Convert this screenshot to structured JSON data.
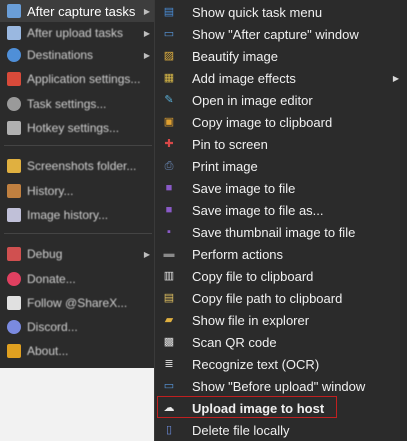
{
  "parent_menu": {
    "items": [
      {
        "label": "After capture tasks",
        "icon": "capture-tasks-icon",
        "color": "#6a9ed8"
      },
      {
        "label": "After upload tasks",
        "icon": "cloud-upload-icon",
        "color": "#9ab8e0"
      },
      {
        "label": "Destinations",
        "icon": "globe-icon",
        "color": "#4f8fd8"
      },
      {
        "label": "Application settings...",
        "icon": "tools-icon",
        "color": "#d84a3a"
      },
      {
        "label": "Task settings...",
        "icon": "gear-icon",
        "color": "#9a9a9a"
      },
      {
        "label": "Hotkey settings...",
        "icon": "keyboard-icon",
        "color": "#b0b0b0"
      },
      {
        "label": "Screenshots folder...",
        "icon": "folder-icon",
        "color": "#e0b040"
      },
      {
        "label": "History...",
        "icon": "history-icon",
        "color": "#c08040"
      },
      {
        "label": "Image history...",
        "icon": "image-history-icon",
        "color": "#c0c0d8"
      },
      {
        "label": "Debug",
        "icon": "bug-icon",
        "color": "#d05050"
      },
      {
        "label": "Donate...",
        "icon": "heart-icon",
        "color": "#e04060"
      },
      {
        "label": "Follow @ShareX...",
        "icon": "x-logo-icon",
        "color": "#e0e0e0"
      },
      {
        "label": "Discord...",
        "icon": "discord-icon",
        "color": "#7a8ae0"
      },
      {
        "label": "About...",
        "icon": "crown-icon",
        "color": "#e0a020"
      }
    ]
  },
  "submenu": {
    "items": [
      {
        "label": "Show quick task menu",
        "icon": "quick-task-menu-icon",
        "glyph": "▤",
        "color": "#4a8ed8"
      },
      {
        "label": "Show \"After capture\" window",
        "icon": "window-icon",
        "glyph": "▭",
        "color": "#5a9ae0"
      },
      {
        "label": "Beautify image",
        "icon": "beautify-icon",
        "glyph": "▨",
        "color": "#e0b040"
      },
      {
        "label": "Add image effects",
        "icon": "image-effects-icon",
        "glyph": "▦",
        "color": "#d8b848"
      },
      {
        "label": "Open in image editor",
        "icon": "image-editor-icon",
        "glyph": "✎",
        "color": "#5ab0d8"
      },
      {
        "label": "Copy image to clipboard",
        "icon": "clipboard-image-icon",
        "glyph": "▣",
        "color": "#e0a030"
      },
      {
        "label": "Pin to screen",
        "icon": "pin-icon",
        "glyph": "📌",
        "color": "#d84848"
      },
      {
        "label": "Print image",
        "icon": "printer-icon",
        "glyph": "⎙",
        "color": "#6a8ab8"
      },
      {
        "label": "Save image to file",
        "icon": "save-icon",
        "glyph": "▪",
        "color": "#8a5ac8"
      },
      {
        "label": "Save image to file as...",
        "icon": "save-as-icon",
        "glyph": "▪",
        "color": "#8a5ac8"
      },
      {
        "label": "Save thumbnail image to file",
        "icon": "save-thumbnail-icon",
        "glyph": "▫",
        "color": "#8a5ac8"
      },
      {
        "label": "Perform actions",
        "icon": "terminal-icon",
        "glyph": "▬",
        "color": "#7a7a7a"
      },
      {
        "label": "Copy file to clipboard",
        "icon": "copy-file-icon",
        "glyph": "▥",
        "color": "#e0e0e0"
      },
      {
        "label": "Copy file path to clipboard",
        "icon": "copy-path-icon",
        "glyph": "▤",
        "color": "#e0c060"
      },
      {
        "label": "Show file in explorer",
        "icon": "explorer-folder-icon",
        "glyph": "▰",
        "color": "#e0b040"
      },
      {
        "label": "Scan QR code",
        "icon": "qr-code-icon",
        "glyph": "▩",
        "color": "#e0e0e0"
      },
      {
        "label": "Recognize text (OCR)",
        "icon": "ocr-icon",
        "glyph": "≣",
        "color": "#d0d0d0"
      },
      {
        "label": "Show \"Before upload\" window",
        "icon": "before-upload-window-icon",
        "glyph": "▭",
        "color": "#5a9ae0"
      },
      {
        "label": "Upload image to host",
        "icon": "cloud-upload-icon",
        "glyph": "☁",
        "color": "#e8e8e8"
      },
      {
        "label": "Delete file locally",
        "icon": "delete-file-icon",
        "glyph": "▯",
        "color": "#6a8ad8"
      }
    ]
  }
}
